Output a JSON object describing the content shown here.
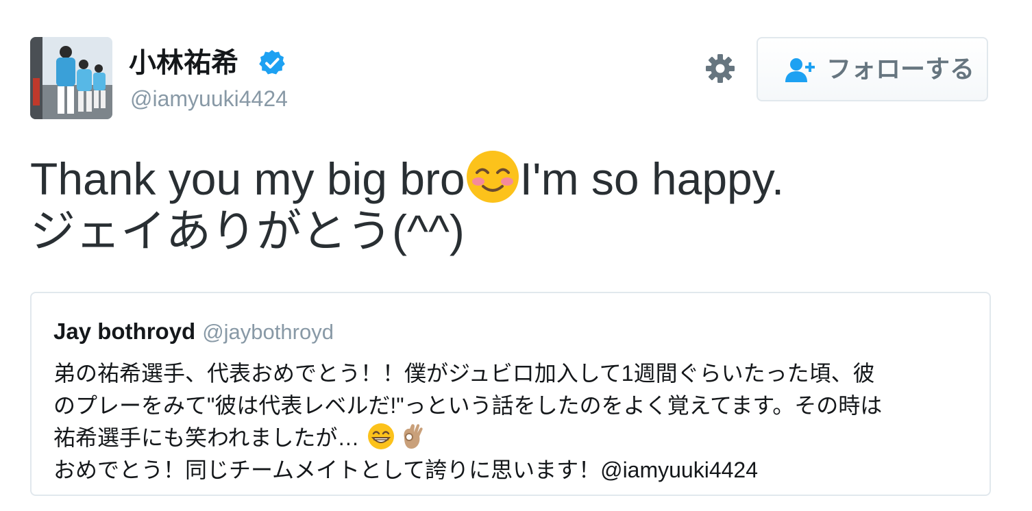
{
  "author": {
    "display_name": "小林祐希",
    "handle": "@iamyuuki4424",
    "verified_icon": "verified-badge-icon"
  },
  "header": {
    "settings_icon": "gear-icon",
    "follow_icon": "add-user-icon",
    "follow_label": "フォローする"
  },
  "tweet": {
    "line1_before_emoji": "Thank you my big bro",
    "line1_emoji": "smiling-face-with-blush-emoji",
    "line1_after_emoji": "I'm so happy.",
    "line2": "ジェイありがとう(^^)"
  },
  "quoted_tweet": {
    "display_name": "Jay bothroyd",
    "handle": "@jaybothroyd",
    "lines": [
      "弟の祐希選手、代表おめでとう！！僕がジュビロ加入して1週間ぐらいたった頃、彼",
      "のプレーをみて\"彼は代表レベルだ!\"っという話をしたのをよく覚えてます。その時は",
      "祐希選手にも笑われましたが…",
      "おめでとう！同じチームメイトとして誇りに思います！@iamyuuki4424"
    ],
    "line3_emojis": [
      "grinning-face-emoji",
      "ok-hand-emoji"
    ]
  },
  "colors": {
    "text_primary": "#14171a",
    "text_secondary": "#8899a6",
    "verified_blue": "#1da1f2",
    "follow_icon_blue": "#1da1f2",
    "border": "#e1e8ed"
  }
}
